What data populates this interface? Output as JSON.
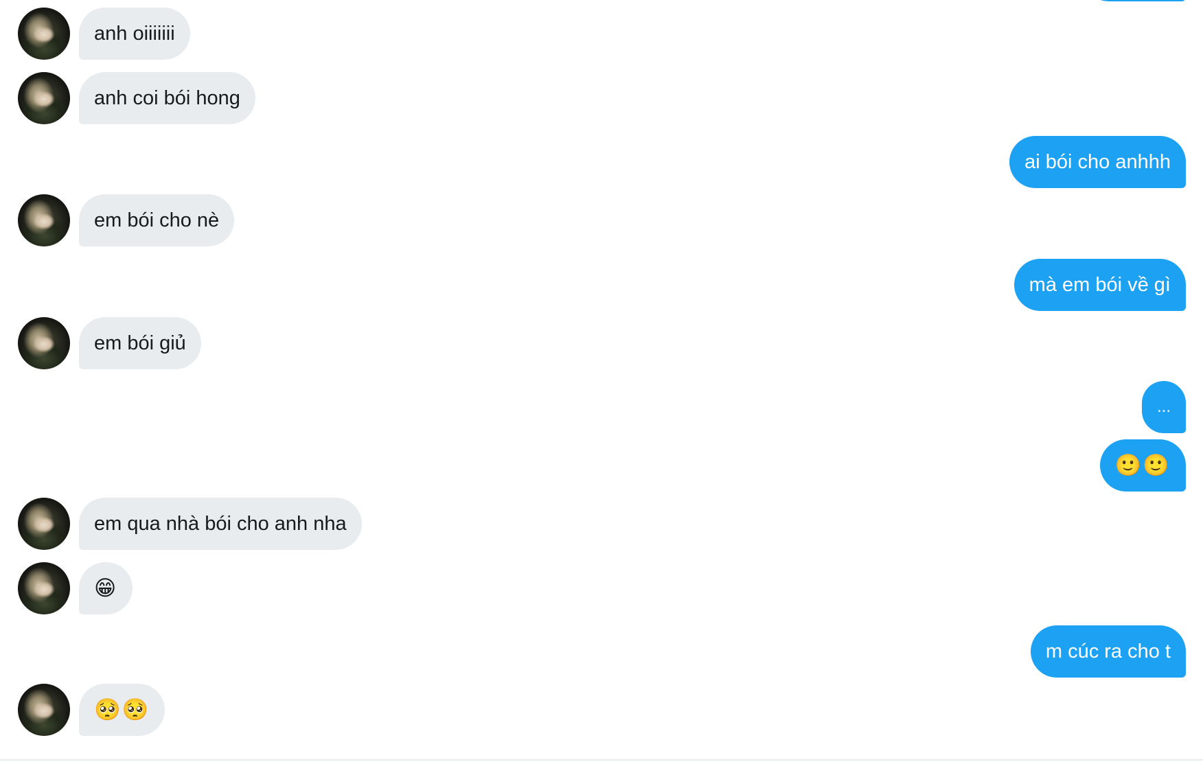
{
  "conversation": {
    "messages": [
      {
        "sender": "them",
        "text": "anh oiiiiiii"
      },
      {
        "sender": "them",
        "text": "anh coi bói hong"
      },
      {
        "sender": "me",
        "text": "ai bói cho anhhh"
      },
      {
        "sender": "them",
        "text": "em bói cho nè"
      },
      {
        "sender": "me",
        "text": "mà em bói về gì"
      },
      {
        "sender": "them",
        "text": "em bói giủ"
      },
      {
        "sender": "me",
        "text": "..."
      },
      {
        "sender": "me",
        "text": "🙂🙂"
      },
      {
        "sender": "them",
        "text": "em qua nhà bói cho anh nha"
      },
      {
        "sender": "them",
        "text": "😁"
      },
      {
        "sender": "me",
        "text": "m cúc ra cho t"
      },
      {
        "sender": "them",
        "text": "🥺🥺"
      }
    ]
  },
  "colors": {
    "incoming_bubble": "#e8ecef",
    "outgoing_bubble": "#1da1f2",
    "incoming_text": "#17191c",
    "outgoing_text": "#ffffff"
  }
}
